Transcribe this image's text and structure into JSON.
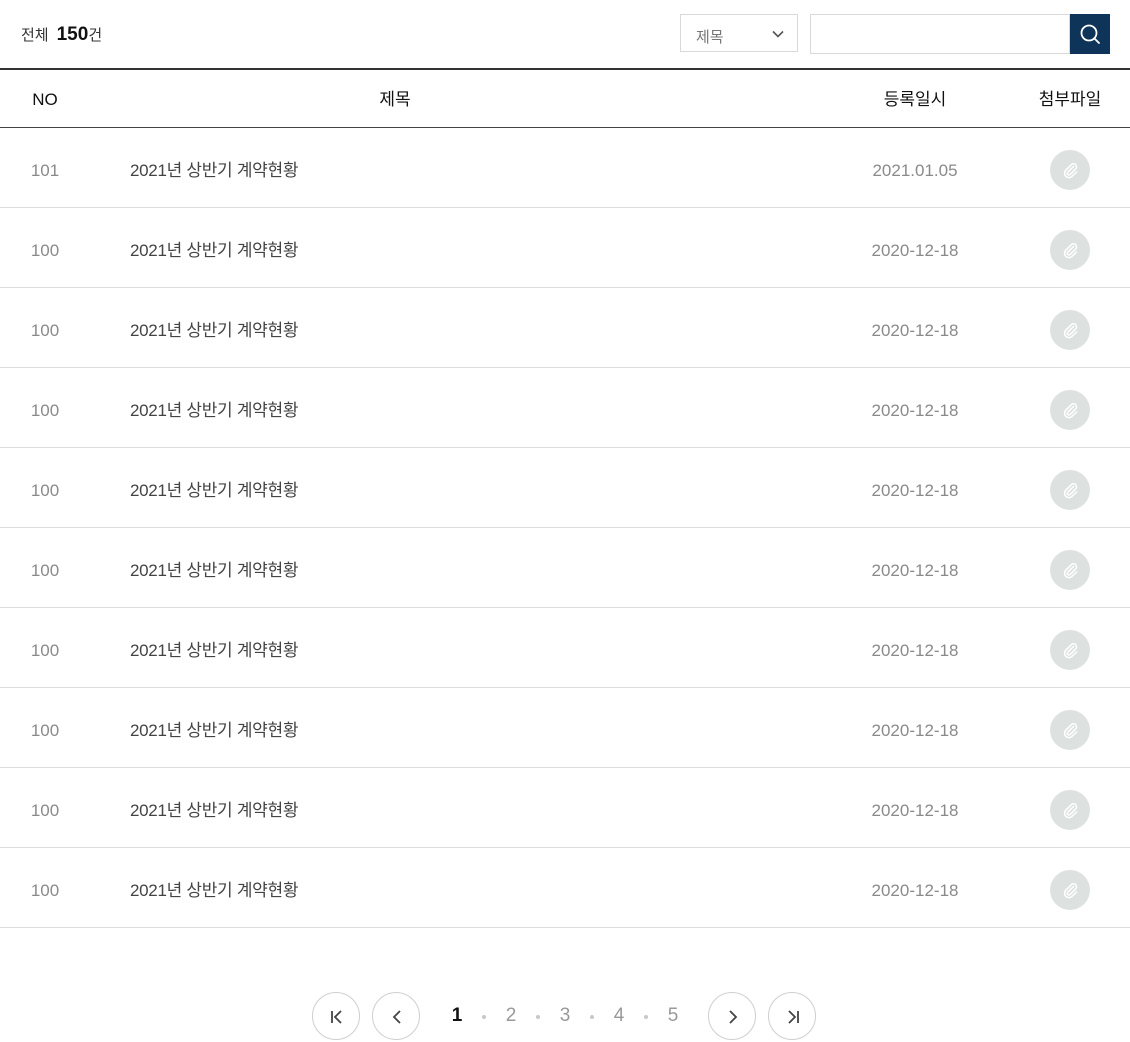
{
  "summary": {
    "label": "전체",
    "count": "150",
    "unit": "건"
  },
  "search": {
    "category": "제목",
    "query": ""
  },
  "table": {
    "headers": {
      "no": "NO",
      "title": "제목",
      "date": "등록일시",
      "file": "첨부파일"
    },
    "rows": [
      {
        "no": "101",
        "title": "2021년 상반기 계약현황",
        "date": "2021.01.05"
      },
      {
        "no": "100",
        "title": "2021년 상반기 계약현황",
        "date": "2020-12-18"
      },
      {
        "no": "100",
        "title": "2021년 상반기 계약현황",
        "date": "2020-12-18"
      },
      {
        "no": "100",
        "title": "2021년 상반기 계약현황",
        "date": "2020-12-18"
      },
      {
        "no": "100",
        "title": "2021년 상반기 계약현황",
        "date": "2020-12-18"
      },
      {
        "no": "100",
        "title": "2021년 상반기 계약현황",
        "date": "2020-12-18"
      },
      {
        "no": "100",
        "title": "2021년 상반기 계약현황",
        "date": "2020-12-18"
      },
      {
        "no": "100",
        "title": "2021년 상반기 계약현황",
        "date": "2020-12-18"
      },
      {
        "no": "100",
        "title": "2021년 상반기 계약현황",
        "date": "2020-12-18"
      },
      {
        "no": "100",
        "title": "2021년 상반기 계약현황",
        "date": "2020-12-18"
      }
    ]
  },
  "pagination": {
    "pages": [
      "1",
      "2",
      "3",
      "4",
      "5"
    ],
    "current": "1"
  },
  "colors": {
    "search_button": "#0e3459",
    "attach_bg": "#dde2e1",
    "attach_icon": "#ffffff"
  },
  "icons": {
    "search": "search-icon",
    "dropdown": "chevron-down-icon",
    "attachment": "paperclip-icon",
    "first": "first-page-icon",
    "prev": "chevron-left-icon",
    "next": "chevron-right-icon",
    "last": "last-page-icon"
  }
}
